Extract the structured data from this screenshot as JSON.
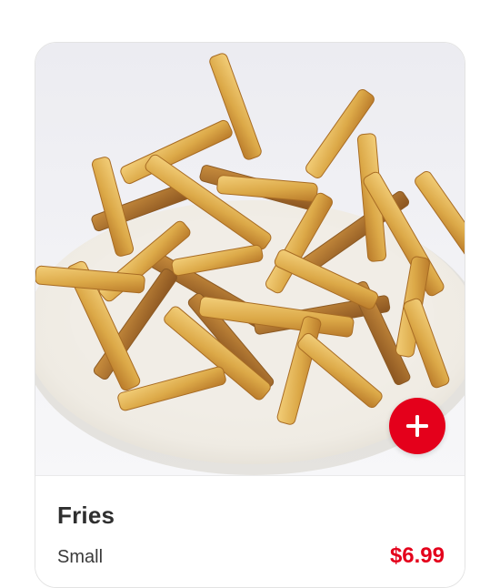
{
  "item": {
    "name": "Fries",
    "size_label": "Small",
    "price": "$6.99"
  },
  "image": {
    "alt": "Plate of fries"
  },
  "add_button": {
    "icon": "plus-icon",
    "color": "#e4001b"
  },
  "colors": {
    "accent": "#e4001b",
    "title": "#2f2f2f"
  }
}
